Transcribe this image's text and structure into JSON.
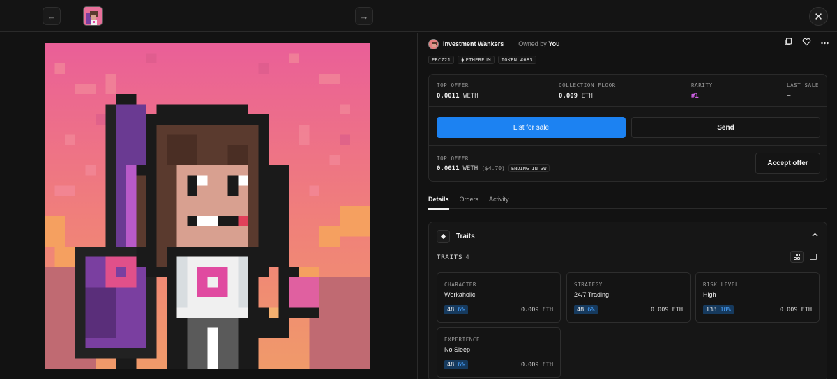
{
  "nav": {
    "back_icon": "←",
    "forward_icon": "→",
    "close_icon": "✕"
  },
  "item": {
    "collection": "Investment Wankers",
    "owned_prefix": "Owned by",
    "owner": "You",
    "chips": [
      "ERC721",
      "ETHEREUM",
      "TOKEN #683"
    ],
    "eth_glyph": "⧫"
  },
  "stats": {
    "top_offer": {
      "label": "TOP OFFER",
      "amount": "0.0011",
      "unit": "WETH"
    },
    "collection_floor": {
      "label": "COLLECTION FLOOR",
      "amount": "0.009",
      "unit": "ETH"
    },
    "rarity": {
      "label": "RARITY",
      "value": "#1"
    },
    "last_sale": {
      "label": "LAST SALE",
      "value": "–"
    }
  },
  "actions": {
    "list_for_sale": "List for sale",
    "send": "Send",
    "accept_offer": "Accept offer"
  },
  "offer": {
    "label": "TOP OFFER",
    "amount": "0.0011",
    "unit": "WETH",
    "usd": "($4.70)",
    "ending": "ENDING IN 3W"
  },
  "tabs": [
    "Details",
    "Orders",
    "Activity"
  ],
  "traits": {
    "title": "Traits",
    "section_label": "TRAITS",
    "count": "4",
    "items": [
      {
        "type": "CHARACTER",
        "value": "Workaholic",
        "count": "48",
        "pct": "6%",
        "price": "0.009 ETH"
      },
      {
        "type": "STRATEGY",
        "value": "24/7 Trading",
        "count": "48",
        "pct": "6%",
        "price": "0.009 ETH"
      },
      {
        "type": "RISK LEVEL",
        "value": "High",
        "count": "138",
        "pct": "18%",
        "price": "0.009 ETH"
      },
      {
        "type": "EXPERIENCE",
        "value": "No Sleep",
        "count": "48",
        "pct": "6%",
        "price": "0.009 ETH"
      }
    ]
  },
  "colors": {
    "primary": "#1c82f2",
    "rarity": "#d061e6",
    "trait_badge_bg": "#163a5e",
    "trait_pct": "#4aa3ff"
  },
  "icons": [
    "arrow-left-icon",
    "arrow-right-icon",
    "close-icon",
    "copy-icon",
    "heart-icon",
    "more-icon",
    "diamond-icon",
    "chevron-up-icon",
    "grid-view-icon",
    "list-view-icon"
  ]
}
